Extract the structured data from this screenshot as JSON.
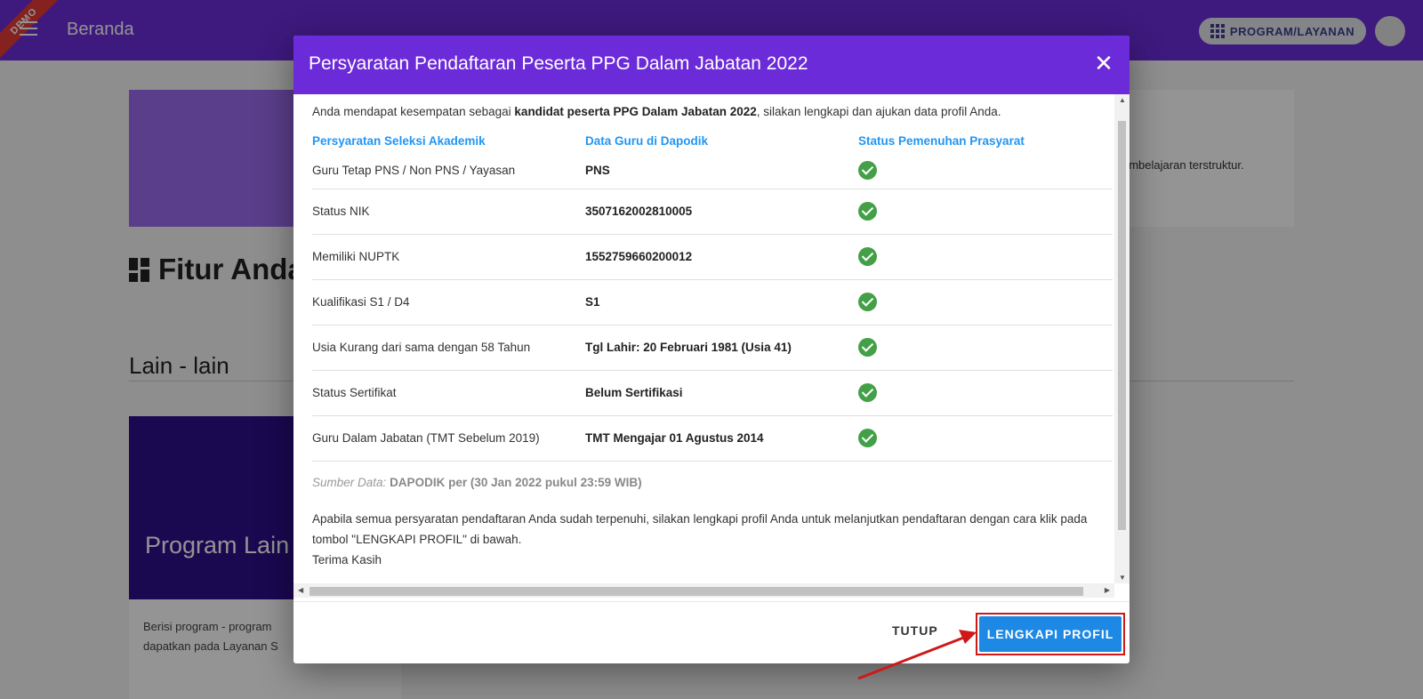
{
  "topbar": {
    "demo_label": "DEMO",
    "title": "Beranda",
    "program_button": "PROGRAM/LAYANAN"
  },
  "background": {
    "hero_text": "embelajaran terstruktur.",
    "fitur_title": "Fitur Anda",
    "lain_title": "Lain - lain",
    "program_card": {
      "title": "Program Lain",
      "desc_line1": "Berisi program - program",
      "desc_line2": "dapatkan pada Layanan S"
    }
  },
  "modal": {
    "title": "Persyaratan Pendaftaran Peserta PPG Dalam Jabatan 2022",
    "intro_pre": "Anda mendapat kesempatan sebagai ",
    "intro_bold": "kandidat peserta PPG Dalam Jabatan 2022",
    "intro_post": ", silakan lengkapi dan ajukan data profil Anda.",
    "headers": [
      "Persyaratan Seleksi Akademik",
      "Data Guru di Dapodik",
      "Status Pemenuhan Prasyarat"
    ],
    "rows": [
      {
        "req": "Guru Tetap PNS / Non PNS / Yayasan",
        "value": "PNS"
      },
      {
        "req": "Status NIK",
        "value": "3507162002810005"
      },
      {
        "req": "Memiliki NUPTK",
        "value": "1552759660200012"
      },
      {
        "req": "Kualifikasi S1 / D4",
        "value": "S1"
      },
      {
        "req": "Usia Kurang dari sama dengan 58 Tahun",
        "value": "Tgl Lahir: 20 Februari 1981 (Usia 41)"
      },
      {
        "req": "Status Sertifikat",
        "value": "Belum Sertifikasi"
      },
      {
        "req": "Guru Dalam Jabatan (TMT Sebelum 2019)",
        "value": "TMT Mengajar 01 Agustus 2014"
      }
    ],
    "source_label": "Sumber Data:",
    "source_value": "DAPODIK per (30 Jan 2022 pukul 23:59 WIB)",
    "paragraph": "Apabila semua persyaratan pendaftaran Anda sudah terpenuhi, silakan lengkapi profil Anda untuk melanjutkan pendaftaran dengan cara klik pada tombol \"LENGKAPI PROFIL\" di bawah.",
    "closing": "Terima Kasih",
    "tutup_button": "TUTUP",
    "lengkapi_button": "LENGKAPI PROFIL"
  },
  "colors": {
    "brand": "#6c2bd9",
    "header_text": "#2196f3",
    "check": "#43a047",
    "primary_button": "#1e88e5",
    "highlight": "#d01818"
  }
}
